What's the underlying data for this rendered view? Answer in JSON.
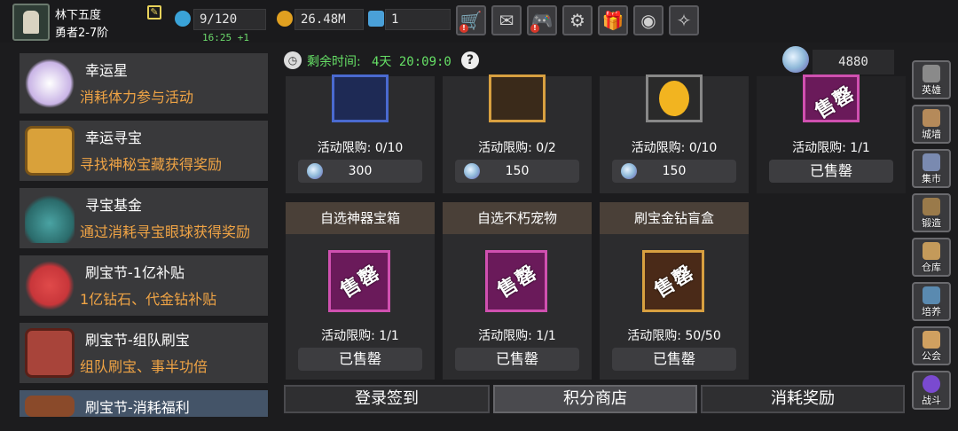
{
  "player": {
    "name": "林下五度",
    "rank": "勇者2-7阶"
  },
  "resources": {
    "stamina": "9/120",
    "stamina_timer": "16:25 +1",
    "gold": "26.48M",
    "gems": "1"
  },
  "toolbar_icons": [
    "cart-icon",
    "mail-icon",
    "gamepad-icon",
    "gear-icon",
    "gift-icon",
    "aperture-icon",
    "sparkle-icon"
  ],
  "sidebar": {
    "items": [
      {
        "title": "幸运星",
        "desc": "消耗体力参与活动",
        "icon": "star-gem-icon",
        "color": "#c9b4e6"
      },
      {
        "title": "幸运寻宝",
        "desc": "寻找神秘宝藏获得奖励",
        "icon": "treasure-box-icon",
        "color": "#d9a13a"
      },
      {
        "title": "寻宝基金",
        "desc": "通过消耗寻宝眼球获得奖励",
        "icon": "potion-jar-icon",
        "color": "#4aa3a3"
      },
      {
        "title": "刷宝节-1亿补贴",
        "desc": "1亿钻石、代金钻补贴",
        "icon": "red-flower-icon",
        "color": "#c8363a"
      },
      {
        "title": "刷宝节-组队刷宝",
        "desc": "组队刷宝、事半功倍",
        "icon": "red-chest-icon",
        "color": "#a8443a"
      },
      {
        "title": "刷宝节-消耗福利",
        "desc": "",
        "icon": "chest-icon",
        "color": "#8a4a2a"
      }
    ]
  },
  "header": {
    "time_label": "剩余时间:",
    "time_value": "4天 20:09:0",
    "gem_total": "4880"
  },
  "shop": {
    "top_row": [
      {
        "limit": "活动限购: 0/10",
        "price": "300",
        "img_color": "#1e2a55"
      },
      {
        "limit": "活动限购: 0/2",
        "price": "150",
        "img_color": "#3a2a1a"
      },
      {
        "limit": "活动限购: 0/10",
        "price": "150",
        "img_color": "#2a2a2a"
      },
      {
        "limit": "活动限购: 1/1",
        "sold": "已售罄",
        "stamp": "售罄",
        "img_color": "#6a1a5a"
      }
    ],
    "bottom_row": [
      {
        "title": "自选神器宝箱",
        "limit": "活动限购: 1/1",
        "sold": "已售罄",
        "stamp": "售罄",
        "img_color": "#6a1a5a"
      },
      {
        "title": "自选不朽宠物",
        "limit": "活动限购: 1/1",
        "sold": "已售罄",
        "stamp": "售罄",
        "img_color": "#6a1a5a"
      },
      {
        "title": "刷宝金钻盲盒",
        "limit": "活动限购: 50/50",
        "sold": "已售罄",
        "stamp": "售罄",
        "img_color": "#4a2a18"
      }
    ]
  },
  "tabs": [
    {
      "label": "登录签到",
      "active": false
    },
    {
      "label": "积分商店",
      "active": true
    },
    {
      "label": "消耗奖励",
      "active": false
    }
  ],
  "right_nav": [
    {
      "label": "英雄",
      "icon": "helmet-icon",
      "color": "#8a8a8a"
    },
    {
      "label": "城墙",
      "icon": "wall-icon",
      "color": "#b58a5a"
    },
    {
      "label": "集市",
      "icon": "market-icon",
      "color": "#7a8ab0"
    },
    {
      "label": "锻造",
      "icon": "anvil-icon",
      "color": "#9a7a4a"
    },
    {
      "label": "仓库",
      "icon": "warehouse-icon",
      "color": "#c49a5a"
    },
    {
      "label": "培养",
      "icon": "chalice-icon",
      "color": "#5a8ab0"
    },
    {
      "label": "公会",
      "icon": "guild-icon",
      "color": "#d0a060"
    },
    {
      "label": "战斗",
      "icon": "vortex-icon",
      "color": "#7a4ad0"
    }
  ]
}
